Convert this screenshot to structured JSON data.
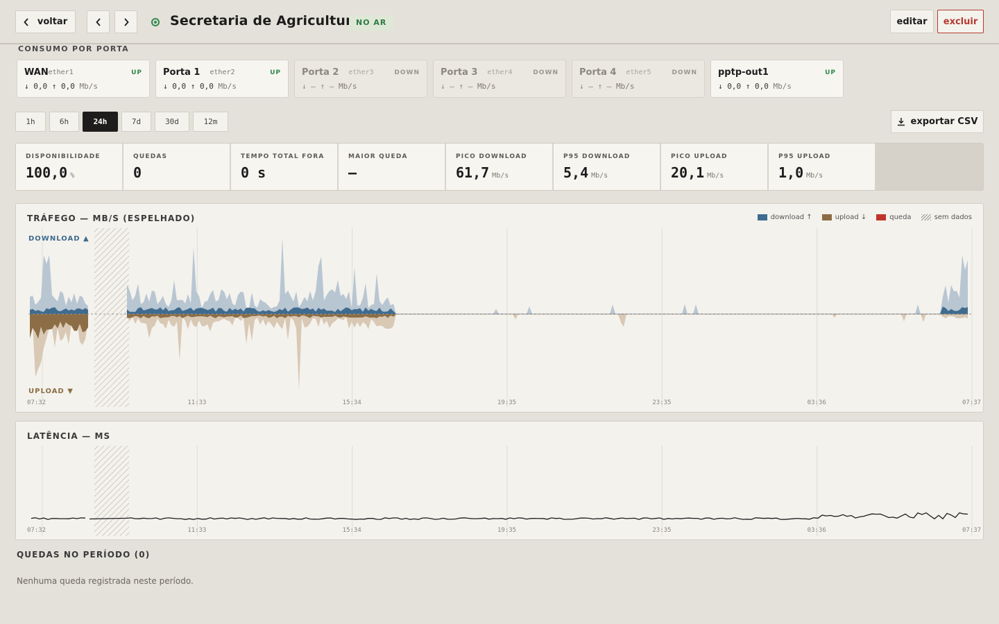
{
  "header": {
    "back_label": "voltar",
    "title": "Secretaria de Agricultura",
    "status_badge": "NO AR",
    "edit_label": "editar",
    "delete_label": "excluir"
  },
  "ports_section": {
    "label": "CONSUMO POR PORTA",
    "ports": [
      {
        "name": "WAN",
        "iface": "ether1",
        "state": "UP",
        "down": "0,0",
        "up": "0,0",
        "unit": "Mb/s"
      },
      {
        "name": "Porta 1",
        "iface": "ether2",
        "state": "UP",
        "down": "0,0",
        "up": "0,0",
        "unit": "Mb/s"
      },
      {
        "name": "Porta 2",
        "iface": "ether3",
        "state": "DOWN",
        "down": "–",
        "up": "–",
        "unit": "Mb/s"
      },
      {
        "name": "Porta 3",
        "iface": "ether4",
        "state": "DOWN",
        "down": "–",
        "up": "–",
        "unit": "Mb/s"
      },
      {
        "name": "Porta 4",
        "iface": "ether5",
        "state": "DOWN",
        "down": "–",
        "up": "–",
        "unit": "Mb/s"
      },
      {
        "name": "pptp-out1",
        "iface": "",
        "state": "UP",
        "down": "0,0",
        "up": "0,0",
        "unit": "Mb/s"
      }
    ]
  },
  "range": {
    "options": [
      "1h",
      "6h",
      "24h",
      "7d",
      "30d",
      "12m"
    ],
    "selected": "24h"
  },
  "export_label": "exportar CSV",
  "stats": [
    {
      "label": "DISPONIBILIDADE",
      "value": "100,0",
      "unit": "%"
    },
    {
      "label": "QUEDAS",
      "value": "0",
      "unit": ""
    },
    {
      "label": "TEMPO TOTAL FORA",
      "value": "0 s",
      "unit": ""
    },
    {
      "label": "MAIOR QUEDA",
      "value": "—",
      "unit": ""
    },
    {
      "label": "PICO DOWNLOAD",
      "value": "61,7",
      "unit": "Mb/s"
    },
    {
      "label": "P95 DOWNLOAD",
      "value": "5,4",
      "unit": "Mb/s"
    },
    {
      "label": "PICO UPLOAD",
      "value": "20,1",
      "unit": "Mb/s"
    },
    {
      "label": "P95 UPLOAD",
      "value": "1,0",
      "unit": "Mb/s"
    }
  ],
  "traffic": {
    "title": "TRÁFEGO — MB/S (ESPELHADO)",
    "legend": [
      {
        "label": "download ↑",
        "color": "#3f6b8f"
      },
      {
        "label": "upload ↓",
        "color": "#8c6d45"
      },
      {
        "label": "queda",
        "color": "#c0352b"
      },
      {
        "label": "sem dados",
        "color": "hatch"
      }
    ],
    "download_label": "DOWNLOAD ▲",
    "upload_label": "UPLOAD ▼",
    "x_ticks": [
      "07:32",
      "11:33",
      "15:34",
      "19:35",
      "23:35",
      "03:36",
      "07:37"
    ],
    "colors": {
      "download_avg": "#3f6b8f",
      "download_peak": "#b8c6d2",
      "upload_avg": "#8c6d45",
      "upload_peak": "#d8c8b4"
    }
  },
  "latency": {
    "title": "LATÊNCIA — MS",
    "x_ticks": [
      "07:32",
      "11:33",
      "15:34",
      "19:35",
      "23:35",
      "03:36",
      "07:37"
    ],
    "color": "#1c1c1c"
  },
  "outages": {
    "title": "QUEDAS NO PERÍODO (0)",
    "empty_text": "Nenhuma queda registrada neste período."
  }
}
